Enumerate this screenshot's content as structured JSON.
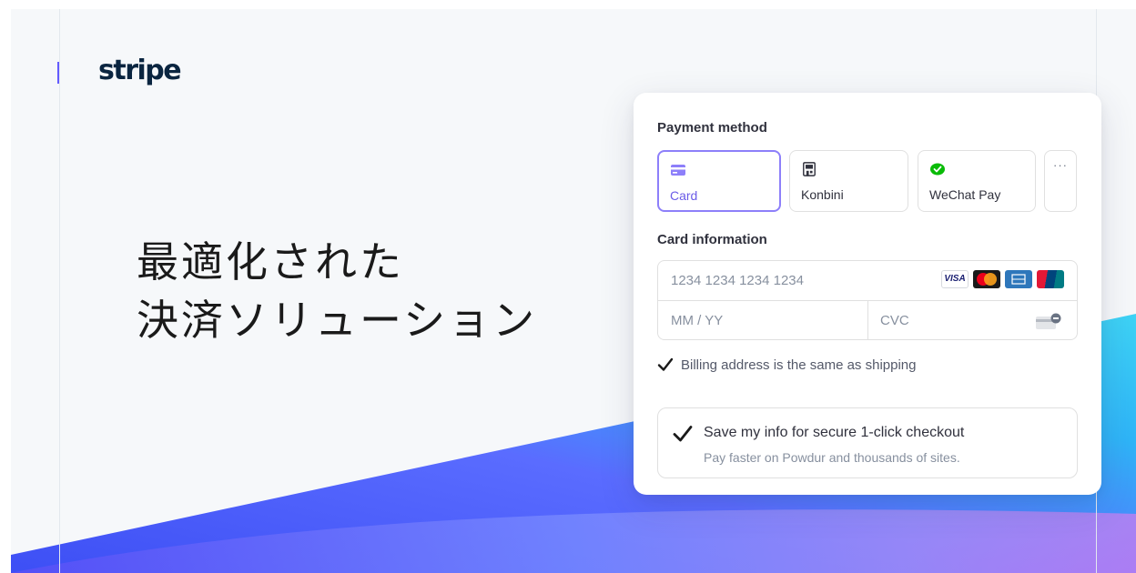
{
  "brand": {
    "logo_text": "stripe",
    "accent": "#635bff"
  },
  "hero": {
    "line1": "最適化された",
    "line2": "決済ソリューション"
  },
  "payment": {
    "method_label": "Payment method",
    "methods": [
      {
        "label": "Card",
        "icon": "credit-card-icon",
        "selected": true
      },
      {
        "label": "Konbini",
        "icon": "convenience-store-icon",
        "selected": false
      },
      {
        "label": "WeChat Pay",
        "icon": "wechat-icon",
        "selected": false
      }
    ],
    "more_label": "···",
    "card_info_label": "Card information",
    "card_number_placeholder": "1234 1234 1234 1234",
    "expiry_placeholder": "MM / YY",
    "cvc_placeholder": "CVC",
    "brands": [
      "VISA",
      "mastercard",
      "amex",
      "unionpay"
    ],
    "billing_same": {
      "label": "Billing address is the same as shipping",
      "checked": true
    },
    "save_info": {
      "title": "Save my info for secure 1-click checkout",
      "subtitle": "Pay faster on Powdur and thousands of sites.",
      "checked": true
    }
  },
  "colors": {
    "selected_tab": "#8d7ffa",
    "text": "#30313d",
    "placeholder": "#87909f",
    "wechat_green": "#09bb07"
  }
}
